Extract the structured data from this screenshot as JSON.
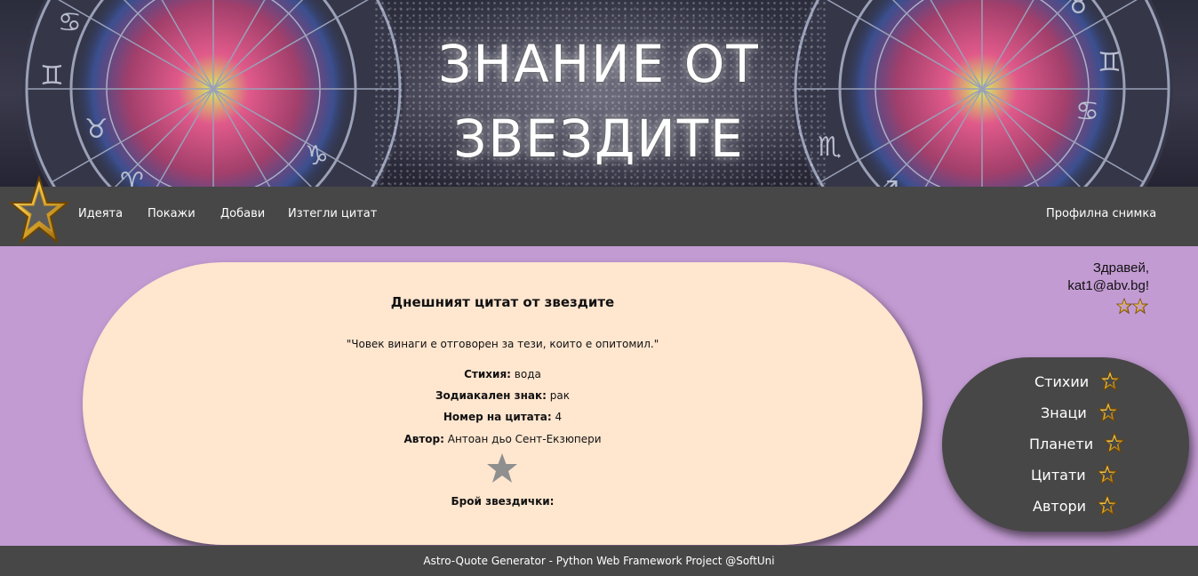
{
  "header": {
    "title_line1": "ЗНАНИЕ ОТ",
    "title_line2": "ЗВЕЗДИТЕ"
  },
  "nav": {
    "items": [
      {
        "label": "Идеята"
      },
      {
        "label": "Покажи"
      },
      {
        "label": "Добави"
      },
      {
        "label": "Изтегли цитат"
      }
    ],
    "profile_label": "Профилна снимка"
  },
  "greeting": {
    "line1": "Здравей,",
    "line2": "kat1@abv.bg!"
  },
  "quote_card": {
    "heading": "Днешният цитат от звездите",
    "quote": "\"Човек винаги е отговорен за тези, които е опитомил.\"",
    "fields": [
      {
        "label": "Стихия",
        "value": "вода"
      },
      {
        "label": "Зодиакален знак",
        "value": "рак"
      },
      {
        "label": "Номер на цитата",
        "value": "4"
      },
      {
        "label": "Автор",
        "value": "Антоан дьо Сент-Екзюпери"
      }
    ],
    "stars_count_label": "Брой звездички:"
  },
  "side_menu": {
    "items": [
      {
        "label": "Стихии"
      },
      {
        "label": "Знаци"
      },
      {
        "label": "Планети"
      },
      {
        "label": "Цитати"
      },
      {
        "label": "Автори"
      }
    ]
  },
  "footer": {
    "text": "Astro-Quote Generator - Python Web Framework Project @SoftUni"
  },
  "colors": {
    "page_background": "#c39bd3",
    "bar_background": "#474747",
    "card_background": "#ffe6cf",
    "star_gold": "#e0b030"
  }
}
